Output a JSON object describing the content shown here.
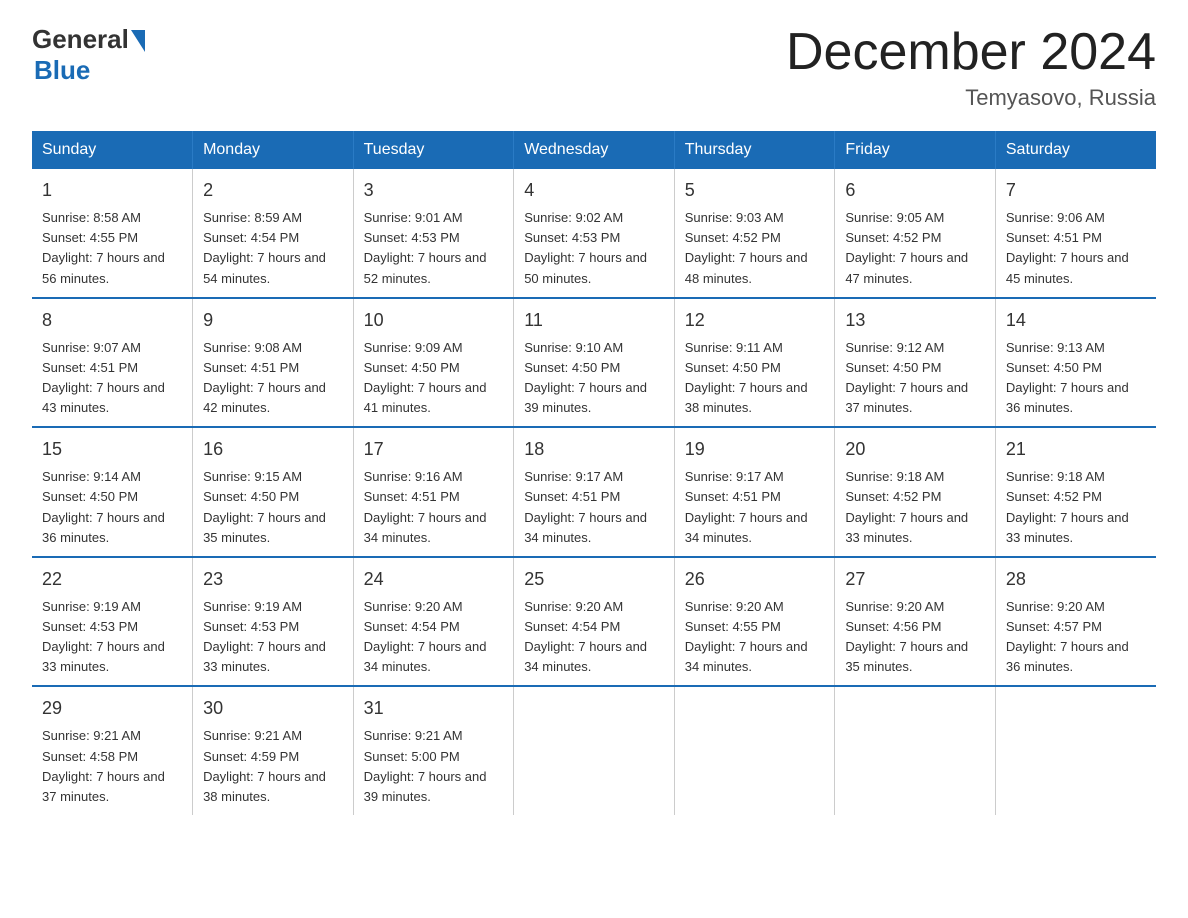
{
  "logo": {
    "general": "General",
    "blue": "Blue"
  },
  "title": "December 2024",
  "location": "Temyasovo, Russia",
  "weekdays": [
    "Sunday",
    "Monday",
    "Tuesday",
    "Wednesday",
    "Thursday",
    "Friday",
    "Saturday"
  ],
  "weeks": [
    [
      {
        "day": "1",
        "sunrise": "8:58 AM",
        "sunset": "4:55 PM",
        "daylight": "7 hours and 56 minutes."
      },
      {
        "day": "2",
        "sunrise": "8:59 AM",
        "sunset": "4:54 PM",
        "daylight": "7 hours and 54 minutes."
      },
      {
        "day": "3",
        "sunrise": "9:01 AM",
        "sunset": "4:53 PM",
        "daylight": "7 hours and 52 minutes."
      },
      {
        "day": "4",
        "sunrise": "9:02 AM",
        "sunset": "4:53 PM",
        "daylight": "7 hours and 50 minutes."
      },
      {
        "day": "5",
        "sunrise": "9:03 AM",
        "sunset": "4:52 PM",
        "daylight": "7 hours and 48 minutes."
      },
      {
        "day": "6",
        "sunrise": "9:05 AM",
        "sunset": "4:52 PM",
        "daylight": "7 hours and 47 minutes."
      },
      {
        "day": "7",
        "sunrise": "9:06 AM",
        "sunset": "4:51 PM",
        "daylight": "7 hours and 45 minutes."
      }
    ],
    [
      {
        "day": "8",
        "sunrise": "9:07 AM",
        "sunset": "4:51 PM",
        "daylight": "7 hours and 43 minutes."
      },
      {
        "day": "9",
        "sunrise": "9:08 AM",
        "sunset": "4:51 PM",
        "daylight": "7 hours and 42 minutes."
      },
      {
        "day": "10",
        "sunrise": "9:09 AM",
        "sunset": "4:50 PM",
        "daylight": "7 hours and 41 minutes."
      },
      {
        "day": "11",
        "sunrise": "9:10 AM",
        "sunset": "4:50 PM",
        "daylight": "7 hours and 39 minutes."
      },
      {
        "day": "12",
        "sunrise": "9:11 AM",
        "sunset": "4:50 PM",
        "daylight": "7 hours and 38 minutes."
      },
      {
        "day": "13",
        "sunrise": "9:12 AM",
        "sunset": "4:50 PM",
        "daylight": "7 hours and 37 minutes."
      },
      {
        "day": "14",
        "sunrise": "9:13 AM",
        "sunset": "4:50 PM",
        "daylight": "7 hours and 36 minutes."
      }
    ],
    [
      {
        "day": "15",
        "sunrise": "9:14 AM",
        "sunset": "4:50 PM",
        "daylight": "7 hours and 36 minutes."
      },
      {
        "day": "16",
        "sunrise": "9:15 AM",
        "sunset": "4:50 PM",
        "daylight": "7 hours and 35 minutes."
      },
      {
        "day": "17",
        "sunrise": "9:16 AM",
        "sunset": "4:51 PM",
        "daylight": "7 hours and 34 minutes."
      },
      {
        "day": "18",
        "sunrise": "9:17 AM",
        "sunset": "4:51 PM",
        "daylight": "7 hours and 34 minutes."
      },
      {
        "day": "19",
        "sunrise": "9:17 AM",
        "sunset": "4:51 PM",
        "daylight": "7 hours and 34 minutes."
      },
      {
        "day": "20",
        "sunrise": "9:18 AM",
        "sunset": "4:52 PM",
        "daylight": "7 hours and 33 minutes."
      },
      {
        "day": "21",
        "sunrise": "9:18 AM",
        "sunset": "4:52 PM",
        "daylight": "7 hours and 33 minutes."
      }
    ],
    [
      {
        "day": "22",
        "sunrise": "9:19 AM",
        "sunset": "4:53 PM",
        "daylight": "7 hours and 33 minutes."
      },
      {
        "day": "23",
        "sunrise": "9:19 AM",
        "sunset": "4:53 PM",
        "daylight": "7 hours and 33 minutes."
      },
      {
        "day": "24",
        "sunrise": "9:20 AM",
        "sunset": "4:54 PM",
        "daylight": "7 hours and 34 minutes."
      },
      {
        "day": "25",
        "sunrise": "9:20 AM",
        "sunset": "4:54 PM",
        "daylight": "7 hours and 34 minutes."
      },
      {
        "day": "26",
        "sunrise": "9:20 AM",
        "sunset": "4:55 PM",
        "daylight": "7 hours and 34 minutes."
      },
      {
        "day": "27",
        "sunrise": "9:20 AM",
        "sunset": "4:56 PM",
        "daylight": "7 hours and 35 minutes."
      },
      {
        "day": "28",
        "sunrise": "9:20 AM",
        "sunset": "4:57 PM",
        "daylight": "7 hours and 36 minutes."
      }
    ],
    [
      {
        "day": "29",
        "sunrise": "9:21 AM",
        "sunset": "4:58 PM",
        "daylight": "7 hours and 37 minutes."
      },
      {
        "day": "30",
        "sunrise": "9:21 AM",
        "sunset": "4:59 PM",
        "daylight": "7 hours and 38 minutes."
      },
      {
        "day": "31",
        "sunrise": "9:21 AM",
        "sunset": "5:00 PM",
        "daylight": "7 hours and 39 minutes."
      },
      null,
      null,
      null,
      null
    ]
  ]
}
